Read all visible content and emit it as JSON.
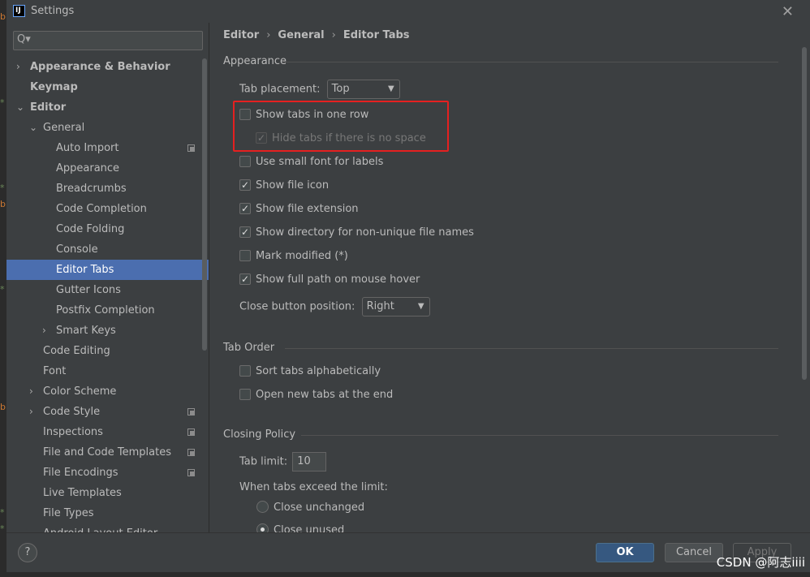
{
  "window": {
    "title": "Settings",
    "app_icon_text": "IJ",
    "close_glyph": "✕"
  },
  "background_editor": {
    "letters": [
      "b",
      "*",
      "*",
      "b",
      "*",
      "b",
      "*",
      "*"
    ]
  },
  "search": {
    "placeholder": "Q▾",
    "icon": "search-icon"
  },
  "tree": [
    {
      "label": "Appearance & Behavior",
      "bold": true,
      "chevron": "›",
      "indent": 0
    },
    {
      "label": "Keymap",
      "bold": true,
      "chevron": "",
      "indent": 0
    },
    {
      "label": "Editor",
      "bold": true,
      "chevron": "⌄",
      "indent": 0
    },
    {
      "label": "General",
      "bold": false,
      "chevron": "⌄",
      "indent": 1
    },
    {
      "label": "Auto Import",
      "indent": 2,
      "copy": true
    },
    {
      "label": "Appearance",
      "indent": 2
    },
    {
      "label": "Breadcrumbs",
      "indent": 2
    },
    {
      "label": "Code Completion",
      "indent": 2
    },
    {
      "label": "Code Folding",
      "indent": 2
    },
    {
      "label": "Console",
      "indent": 2
    },
    {
      "label": "Editor Tabs",
      "indent": 2,
      "selected": true
    },
    {
      "label": "Gutter Icons",
      "indent": 2
    },
    {
      "label": "Postfix Completion",
      "indent": 2
    },
    {
      "label": "Smart Keys",
      "indent": 2,
      "chevron": "›"
    },
    {
      "label": "Code Editing",
      "indent": 1
    },
    {
      "label": "Font",
      "indent": 1
    },
    {
      "label": "Color Scheme",
      "indent": 1,
      "chevron": "›"
    },
    {
      "label": "Code Style",
      "indent": 1,
      "chevron": "›",
      "copy": true
    },
    {
      "label": "Inspections",
      "indent": 1,
      "copy": true
    },
    {
      "label": "File and Code Templates",
      "indent": 1,
      "copy": true
    },
    {
      "label": "File Encodings",
      "indent": 1,
      "copy": true
    },
    {
      "label": "Live Templates",
      "indent": 1
    },
    {
      "label": "File Types",
      "indent": 1
    },
    {
      "label": "Android Layout Editor",
      "indent": 1
    }
  ],
  "breadcrumb": {
    "items": [
      "Editor",
      "General",
      "Editor Tabs"
    ],
    "separator": "›"
  },
  "appearance": {
    "title": "Appearance",
    "tab_placement_label": "Tab placement:",
    "tab_placement_value": "Top",
    "show_tabs_one_row": {
      "label": "Show tabs in one row",
      "checked": false
    },
    "hide_tabs_no_space": {
      "label": "Hide tabs if there is no space",
      "checked": true,
      "disabled": true
    },
    "small_font": {
      "label": "Use small font for labels",
      "checked": false
    },
    "show_file_icon": {
      "label": "Show file icon",
      "checked": true
    },
    "show_file_extension": {
      "label": "Show file extension",
      "checked": true
    },
    "show_directory": {
      "label": "Show directory for non-unique file names",
      "checked": true
    },
    "mark_modified": {
      "label": "Mark modified (*)",
      "checked": false
    },
    "show_full_path": {
      "label": "Show full path on mouse hover",
      "checked": true
    },
    "close_button_label": "Close button position:",
    "close_button_value": "Right"
  },
  "tab_order": {
    "title": "Tab Order",
    "sort_alpha": {
      "label": "Sort tabs alphabetically",
      "checked": false
    },
    "open_at_end": {
      "label": "Open new tabs at the end",
      "checked": false
    }
  },
  "closing_policy": {
    "title": "Closing Policy",
    "tab_limit_label": "Tab limit:",
    "tab_limit_value": "10",
    "exceed_label": "When tabs exceed the limit:",
    "close_unchanged": {
      "label": "Close unchanged",
      "selected": false
    },
    "close_unused": {
      "label": "Close unused",
      "selected": true
    }
  },
  "footer": {
    "help": "?",
    "ok": "OK",
    "cancel": "Cancel",
    "apply": "Apply"
  },
  "watermark": "CSDN @阿志iiii",
  "colors": {
    "selection": "#4b6eaf",
    "highlight_box": "#e52020",
    "ok_button": "#365880"
  }
}
